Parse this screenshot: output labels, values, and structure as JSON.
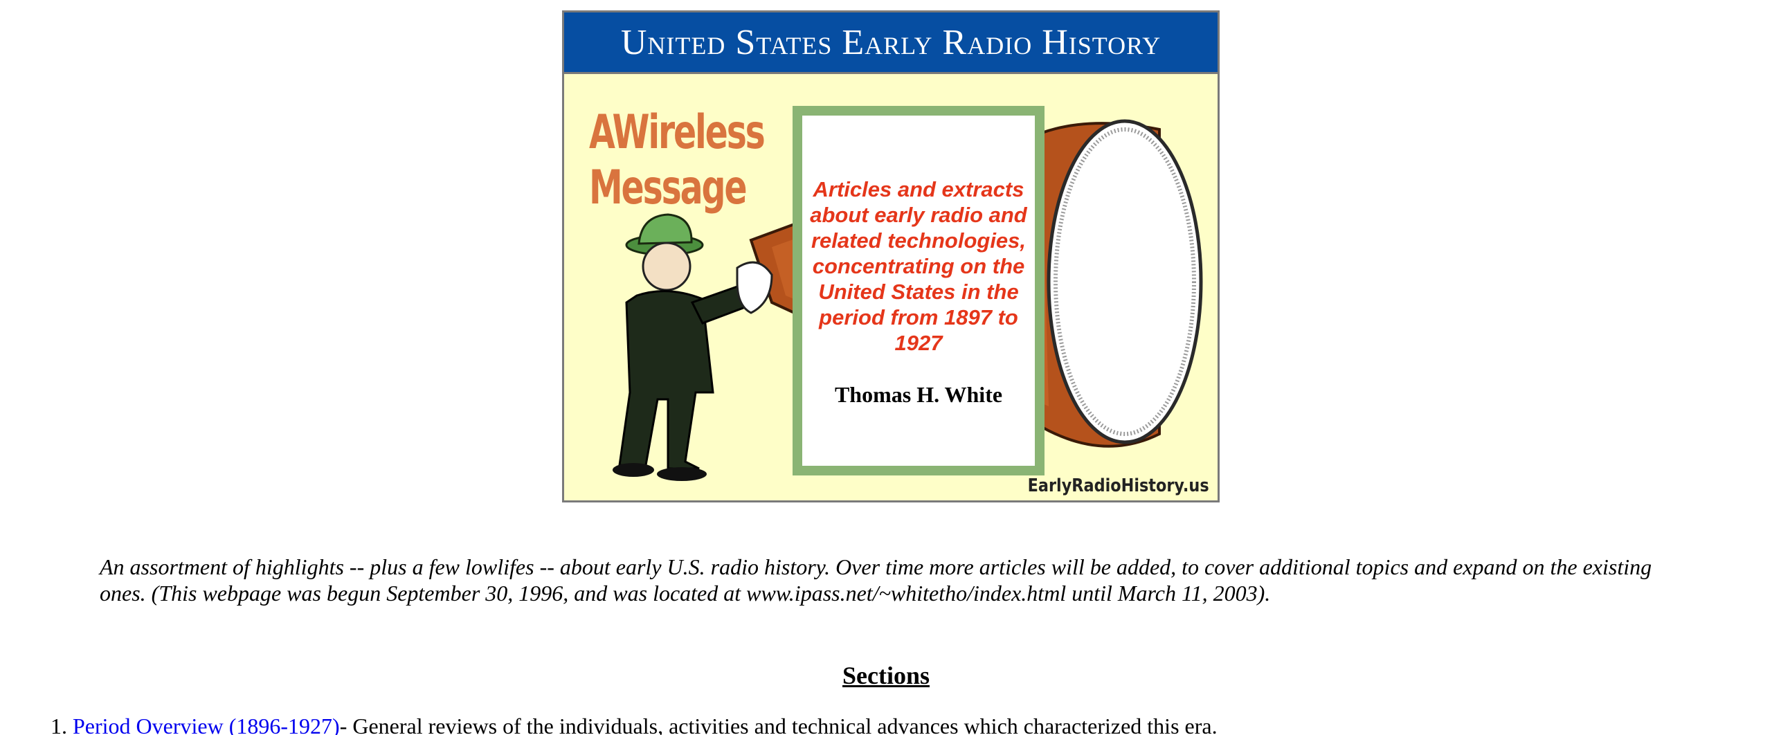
{
  "banner": {
    "title": "United States Early Radio History",
    "art_headline_line1": "AWireless",
    "art_headline_line2": "Message",
    "description": "Articles and extracts about early radio and related technologies, concentrating on the United States in the period from 1897 to 1927",
    "author": "Thomas H. White",
    "site_mark": "EarlyRadioHistory.us",
    "colors": {
      "title_bar": "#064ea2",
      "background": "#fefec8",
      "card_border": "#8ab474",
      "headline": "#d9743e",
      "description": "#e5361a"
    }
  },
  "intro": "An assortment of highlights -- plus a few lowlifes -- about early U.S. radio history. Over time more articles will be added, to cover additional topics and expand on the existing ones. (This webpage was begun September 30, 1996, and was located at www.ipass.net/~whitetho/index.html until March 11, 2003).",
  "sections": {
    "heading": "Sections",
    "items": [
      {
        "number": "1.",
        "link_text": "Period Overview (1896-1927)",
        "description": " - General reviews of the individuals, activities and technical advances which characterized this era."
      }
    ]
  }
}
